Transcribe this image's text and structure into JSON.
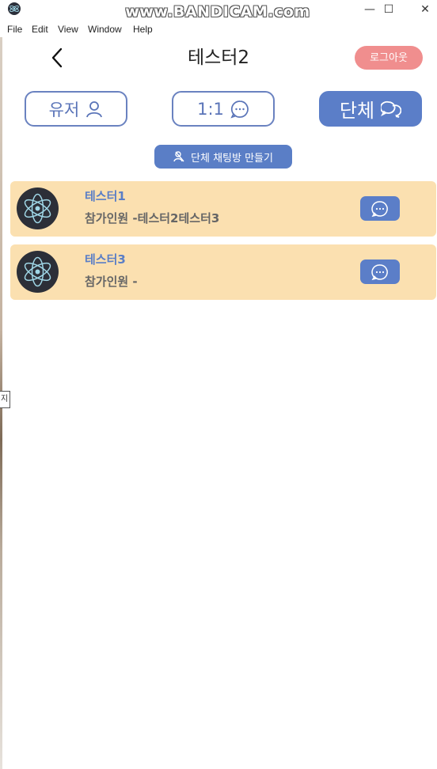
{
  "window": {
    "watermark": "www.BANDICAM.com",
    "minimize": "—",
    "maximize": "☐",
    "close": "✕"
  },
  "menu": [
    "File",
    "Edit",
    "View",
    "Window",
    "Help"
  ],
  "header": {
    "title": "테스터2",
    "logout_label": "로그아웃"
  },
  "tabs": [
    {
      "label": "유저",
      "icon": "user-icon",
      "active": false
    },
    {
      "label": "1:1",
      "icon": "chat-bubble-icon",
      "active": false
    },
    {
      "label": "단체",
      "icon": "group-chat-icon",
      "active": true
    }
  ],
  "create_room_label": "단체 채팅방 만들기",
  "rooms": [
    {
      "name": "테스터1",
      "members": "참가인원 -테스터2테스터3"
    },
    {
      "name": "테스터3",
      "members": "참가인원 -"
    }
  ],
  "tooltip_fragment": "지",
  "colors": {
    "accent": "#5b7ec8",
    "logout": "#f08e8e",
    "room_bg": "#fbe0b0"
  }
}
